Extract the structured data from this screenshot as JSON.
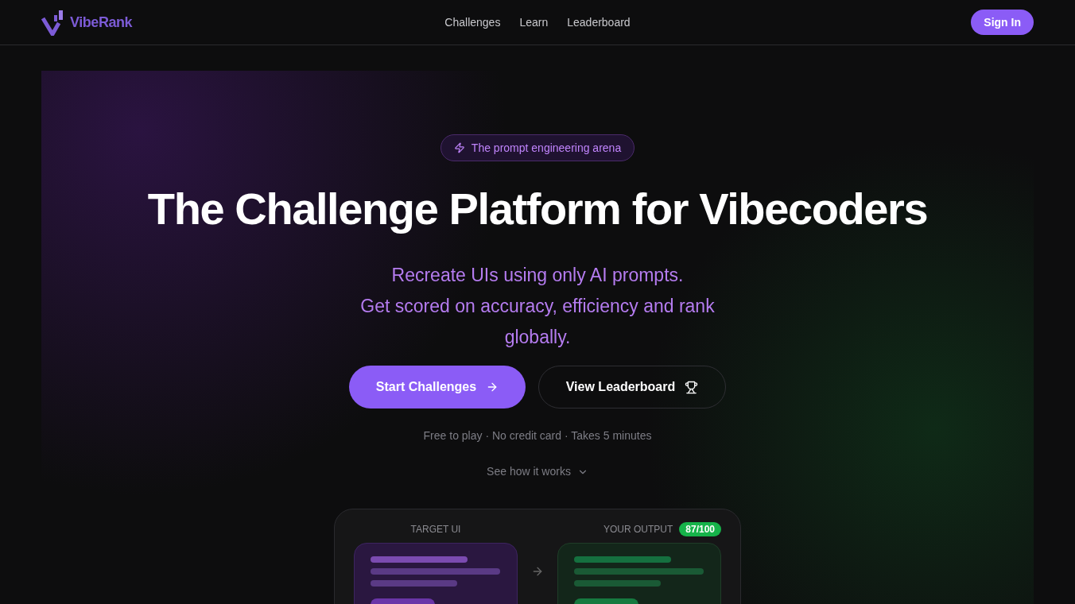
{
  "header": {
    "brand": "VibeRank",
    "nav": [
      {
        "label": "Challenges"
      },
      {
        "label": "Learn"
      },
      {
        "label": "Leaderboard"
      }
    ],
    "sign_in": "Sign In"
  },
  "hero": {
    "badge": "The prompt engineering arena",
    "title": "The Challenge Platform for Vibecoders",
    "subtitle_lines": [
      "Recreate UIs using only AI prompts.",
      "Get scored on accuracy, efficiency and rank globally."
    ],
    "primary_button": "Start Challenges",
    "secondary_button": "View Leaderboard",
    "note": "Free to play · No credit card · Takes 5 minutes",
    "see_how": "See how it works"
  },
  "preview": {
    "target_label": "TARGET UI",
    "output_label": "YOUR OUTPUT",
    "score": "87/100"
  }
}
